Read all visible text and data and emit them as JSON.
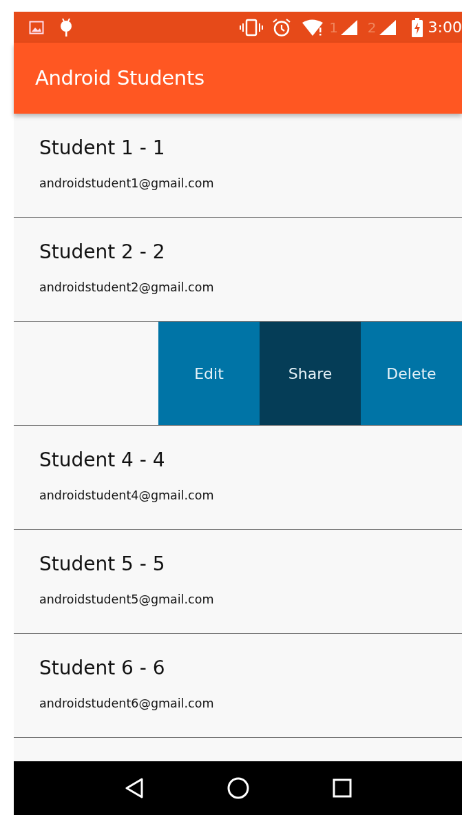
{
  "status_bar": {
    "sim1": "1",
    "sim2": "2",
    "time": "3:00"
  },
  "app_bar": {
    "title": "Android Students"
  },
  "students": [
    {
      "kind": "item",
      "name": "Student 1 - 1",
      "email": "androidstudent1@gmail.com"
    },
    {
      "kind": "item",
      "name": "Student 2 - 2",
      "email": "androidstudent2@gmail.com"
    },
    {
      "kind": "swiped",
      "actions": [
        {
          "label": "Edit",
          "pressed": false
        },
        {
          "label": "Share",
          "pressed": true
        },
        {
          "label": "Delete",
          "pressed": false
        }
      ]
    },
    {
      "kind": "item",
      "name": "Student 4 - 4",
      "email": "androidstudent4@gmail.com"
    },
    {
      "kind": "item",
      "name": "Student 5 - 5",
      "email": "androidstudent5@gmail.com"
    },
    {
      "kind": "item",
      "name": "Student 6 - 6",
      "email": "androidstudent6@gmail.com"
    }
  ]
}
